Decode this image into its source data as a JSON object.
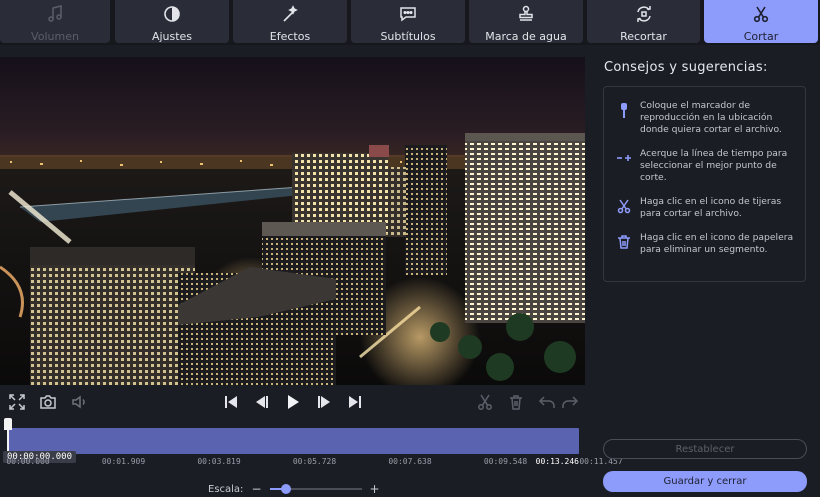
{
  "tabs": [
    {
      "id": "volumen",
      "label": "Volumen",
      "icon": "music-note-icon",
      "state": "disabled"
    },
    {
      "id": "ajustes",
      "label": "Ajustes",
      "icon": "contrast-icon",
      "state": "normal"
    },
    {
      "id": "efectos",
      "label": "Efectos",
      "icon": "magic-wand-icon",
      "state": "normal"
    },
    {
      "id": "subtitulos",
      "label": "Subtítulos",
      "icon": "speech-bubble-icon",
      "state": "normal"
    },
    {
      "id": "marca",
      "label": "Marca de agua",
      "icon": "stamp-icon",
      "state": "normal"
    },
    {
      "id": "recortar",
      "label": "Recortar",
      "icon": "crop-rotate-icon",
      "state": "normal"
    },
    {
      "id": "cortar",
      "label": "Cortar",
      "icon": "scissors-icon",
      "state": "active"
    }
  ],
  "video": {
    "content": "night city skyline time-lapse"
  },
  "controls": {
    "fullscreen": "fullscreen-icon",
    "snapshot": "camera-icon",
    "volume": "speaker-icon",
    "first": "skip-to-start-icon",
    "prev_frame": "step-back-icon",
    "play": "play-icon",
    "next_frame": "step-forward-icon",
    "last": "skip-to-end-icon",
    "cut": "scissors-icon",
    "delete": "trash-icon",
    "undo": "undo-icon",
    "redo": "redo-icon"
  },
  "timeline": {
    "current_time": "00:00:00.000",
    "playhead_fraction": 0,
    "ticks": [
      "00:00.000",
      "00:01.909",
      "00:03.819",
      "00:05.728",
      "00:07.638",
      "00:09.548",
      "00:11.457"
    ],
    "end_time": "00:13.246"
  },
  "scale": {
    "label": "Escala:",
    "minus": "−",
    "plus": "+",
    "value_fraction": 0.18
  },
  "panel": {
    "title": "Consejos y sugerencias:",
    "tips": [
      {
        "icon": "pin-marker-icon",
        "text": "Coloque el marcador de reproducción en la ubicación donde quiera cortar el archivo."
      },
      {
        "icon": "timeline-zoom-icon",
        "text": "Acerque la línea de tiempo para seleccionar el mejor punto de corte."
      },
      {
        "icon": "scissors-icon",
        "text": "Haga clic en el icono de tijeras para cortar el archivo."
      },
      {
        "icon": "trash-icon",
        "text": "Haga clic en el icono de papelera para eliminar un segmento."
      }
    ]
  },
  "buttons": {
    "reset": "Restablecer",
    "save": "Guardar y cerrar"
  },
  "colors": {
    "accent": "#8d9bfb",
    "background": "#1b1d24",
    "track": "#5a63b0"
  }
}
